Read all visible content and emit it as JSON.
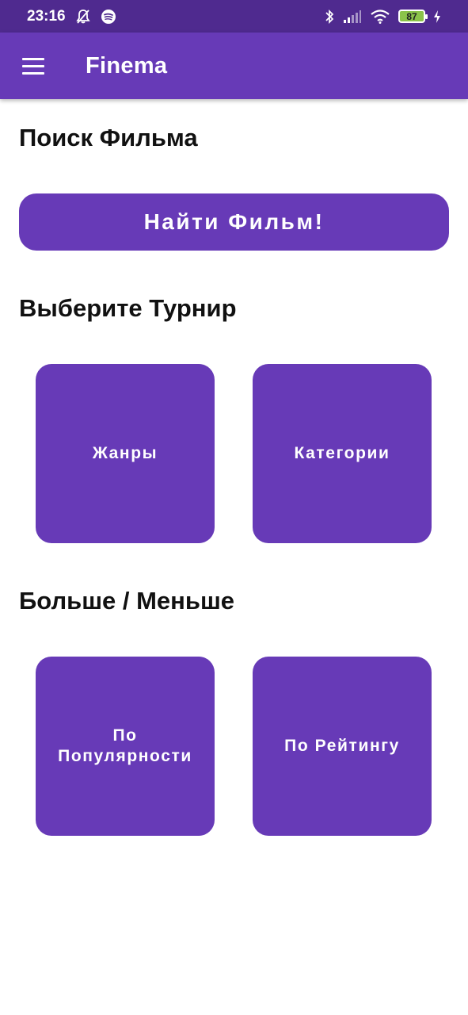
{
  "status_bar": {
    "time": "23:16",
    "left_icons": [
      "bell-off-icon",
      "spotify-icon"
    ],
    "right_icons": [
      "bluetooth-icon",
      "signal-icon",
      "wifi-icon"
    ],
    "battery_level": "87",
    "charging_icon": "lightning-icon"
  },
  "app_bar": {
    "menu_icon": "hamburger-menu-icon",
    "title": "Finema",
    "color": "#673ab7"
  },
  "search_section": {
    "title": "Поиск Фильма",
    "button_label": "Найти Фильм!"
  },
  "tournament_section": {
    "title": "Выберите Турнир",
    "tiles": [
      {
        "label": "Жанры"
      },
      {
        "label": "Категории"
      }
    ]
  },
  "higher_lower_section": {
    "title": "Больше / Меньше",
    "tiles": [
      {
        "label": "По Популярности"
      },
      {
        "label": "По Рейтингу"
      }
    ]
  }
}
